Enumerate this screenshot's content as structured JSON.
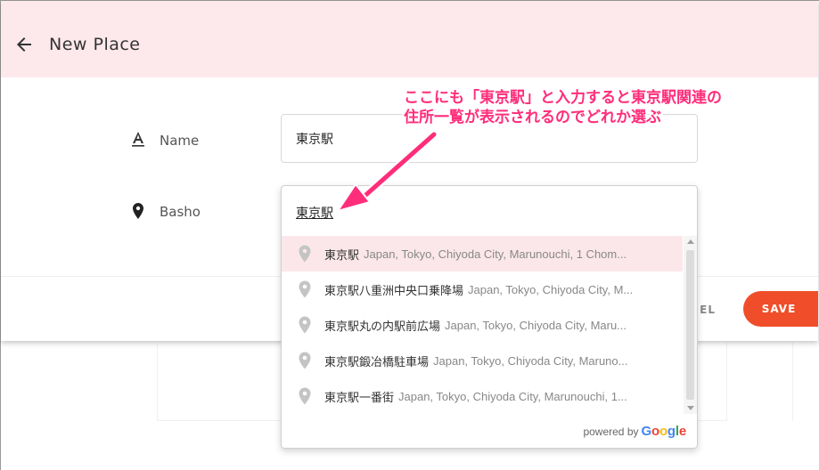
{
  "header": {
    "title": "New Place"
  },
  "form": {
    "name_label": "Name",
    "name_value": "東京駅",
    "basho_label": "Basho",
    "basho_value": "東京駅"
  },
  "footer": {
    "cancel_label": "EL",
    "save_label": "SAVE"
  },
  "suggestions": [
    {
      "main": "東京駅",
      "secondary": "Japan, Tokyo, Chiyoda City, Marunouchi, 1 Chom..."
    },
    {
      "main": "東京駅八重洲中央口乗降場",
      "secondary": "Japan, Tokyo, Chiyoda City, M..."
    },
    {
      "main": "東京駅丸の内駅前広場",
      "secondary": "Japan, Tokyo, Chiyoda City, Maru..."
    },
    {
      "main": "東京駅鍛冶橋駐車場",
      "secondary": "Japan, Tokyo, Chiyoda City, Maruno..."
    },
    {
      "main": "東京駅一番街",
      "secondary": "Japan, Tokyo, Chiyoda City, Marunouchi, 1..."
    }
  ],
  "powered_by": {
    "text": "powered by",
    "brand": "Google"
  },
  "annotation": {
    "line1": "ここにも「東京駅」と入力すると東京駅関連の",
    "line2": "住所一覧が表示されるのでどれか選ぶ"
  },
  "colors": {
    "topbar": "#fde8ec",
    "accent": "#f04e2a",
    "annotation": "#ff2d7a",
    "active_item": "#fbe7ea"
  },
  "icons": {
    "back": "arrow-left-icon",
    "name": "text-format-icon",
    "basho": "location-pin-icon",
    "suggestion": "place-pin-icon"
  }
}
